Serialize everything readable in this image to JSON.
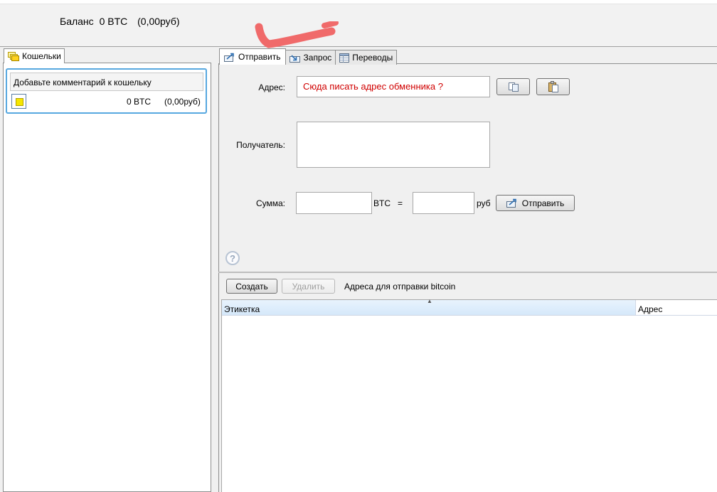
{
  "header": {
    "balance_label": "Баланс",
    "balance_btc": "0 BTC",
    "balance_rub": "(0,00руб)"
  },
  "left": {
    "tab_label": "Кошельки",
    "wallet": {
      "comment_placeholder": "Добавьте комментарий к кошельку",
      "btc": "0 BTC",
      "rub": "(0,00руб)",
      "color": "#f5e600"
    }
  },
  "tabs": [
    {
      "label": "Отправить",
      "active": true
    },
    {
      "label": "Запрос",
      "active": false
    },
    {
      "label": "Переводы",
      "active": false
    }
  ],
  "send_form": {
    "address_label": "Адрес:",
    "address_value": "Сюда писать адрес обменника ?",
    "recipient_label": "Получатель:",
    "amount_label": "Сумма:",
    "btc_unit": "BTC",
    "equals": "=",
    "rub_unit": "руб",
    "send_button": "Отправить",
    "help_symbol": "?"
  },
  "address_list": {
    "create_button": "Создать",
    "delete_button": "Удалить",
    "caption": "Адреса для отправки bitcoin",
    "columns": [
      "Этикетка",
      "Адрес"
    ]
  },
  "colors": {
    "address_text": "#d00000",
    "annotation_arrow": "#f06a6a",
    "selection_border": "#57a8e0"
  }
}
